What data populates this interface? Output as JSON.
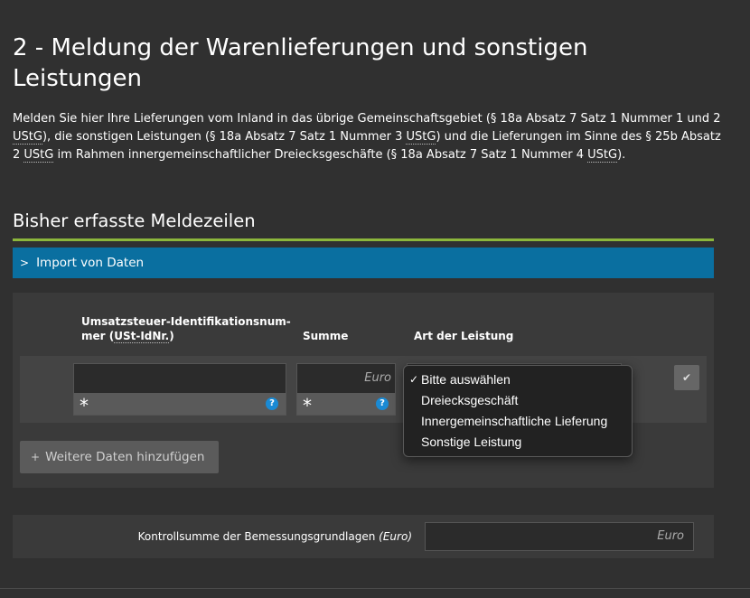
{
  "title": "2 - Meldung der Warenlieferungen und sonstigen Leistungen",
  "intro": {
    "p1": "Melden Sie hier Ihre Lieferungen vom Inland in das übrige Gemeinschaftsgebiet (§ 18a Absatz 7 Satz 1 Nummer 1 und 2 ",
    "abbr1": "UStG",
    "p2": "), die sonstigen Leistungen (§ 18a Absatz 7 Satz 1 Nummer 3 ",
    "abbr2": "UStG",
    "p3": ") und die Lieferungen im Sinne des § 25b Absatz 2 ",
    "abbr3": "UStG",
    "p4": " im Rahmen innergemeinschaftlicher Dreiecksgeschäfte (§ 18a Absatz 7 Satz 1 Nummer 4 ",
    "abbr4": "UStG",
    "p5": ")."
  },
  "section_heading": "Bisher erfasste Meldezeilen",
  "import_bar": {
    "chevron": ">",
    "label": "Import von Daten"
  },
  "table": {
    "col_ustid_line1": "Umsatzsteuer-Identifikationsnum-",
    "col_ustid_line2_a": "mer (",
    "col_ustid_abbr": "USt-IdNr.",
    "col_ustid_line2_b": ")",
    "col_summe": "Summe",
    "col_art": "Art der Leistung",
    "required_marker": "*",
    "help_marker": "?",
    "summe_placeholder": "Euro",
    "check_glyph": "✔"
  },
  "add_button": {
    "plus": "+",
    "label": "Weitere Daten hinzufügen"
  },
  "dropdown": {
    "check": "✓",
    "options": [
      "Bitte auswählen",
      "Dreiecksgeschäft",
      "Innergemeinschaftliche Lieferung",
      "Sonstige Leistung"
    ],
    "selected_index": 0
  },
  "kontrollsumme": {
    "label": "Kontrollsumme der Bemessungsgrundlagen ",
    "label_unit": "(Euro)",
    "placeholder": "Euro"
  },
  "colors": {
    "background": "#303030",
    "accent_green": "#8cb63c",
    "import_blue": "#0a6fa0",
    "help_blue": "#1a8ad4"
  }
}
